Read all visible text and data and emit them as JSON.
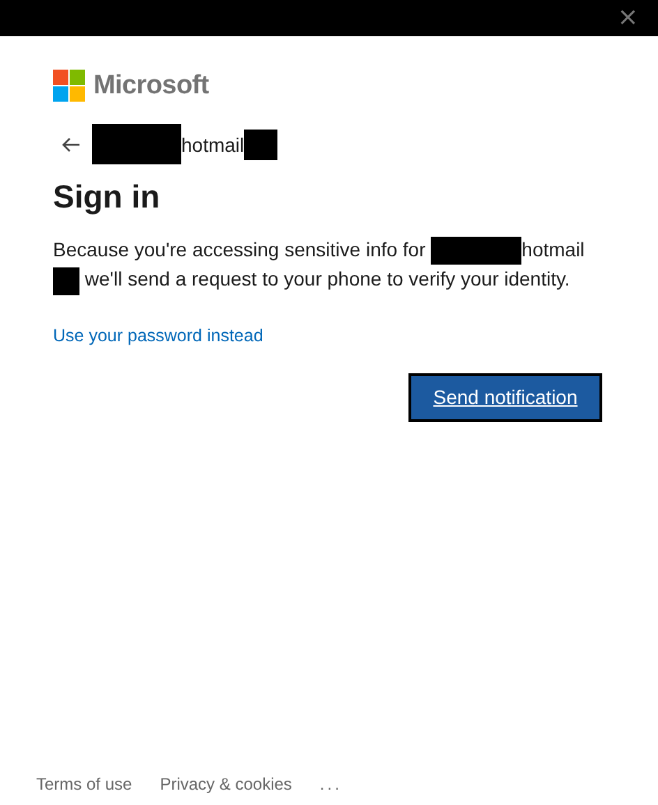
{
  "title_bar": {
    "close": "×"
  },
  "brand": {
    "name": "Microsoft"
  },
  "identity": {
    "text": "hotmail"
  },
  "heading": "Sign in",
  "message": {
    "intro": "Because you're accessing sensitive info for",
    "account": "hotmail",
    "rest": "we'll send a request to your phone to verify your identity."
  },
  "alternate_link": "Use your password instead",
  "primary_button": "Send notification",
  "footer": [
    "Terms of use",
    "Privacy & cookies",
    "..."
  ]
}
